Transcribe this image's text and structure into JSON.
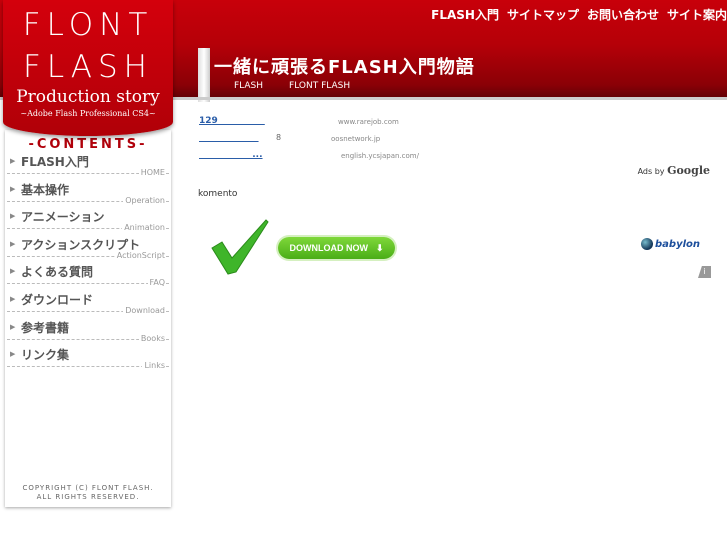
{
  "logo": {
    "line1": "FLONT",
    "line2": "FLASH",
    "line3": "Production story",
    "line4": "~Adobe Flash Professional CS4~"
  },
  "topnav": [
    "FLASH入門",
    "サイトマップ",
    "お問い合わせ",
    "サイト案内"
  ],
  "site_title": "一緒に頑張るFLASH入門物語",
  "subnav": [
    "FLASH",
    "FLONT FLASH"
  ],
  "sidebar": {
    "heading": "-CONTENTS-",
    "items": [
      {
        "jp": "FLASH入門",
        "en": "HOME"
      },
      {
        "jp": "基本操作",
        "en": "Operation"
      },
      {
        "jp": "アニメーション",
        "en": "Animation"
      },
      {
        "jp": "アクションスクリプト",
        "en": "ActionScript"
      },
      {
        "jp": "よくある質問",
        "en": "FAQ"
      },
      {
        "jp": "ダウンロード",
        "en": "Download"
      },
      {
        "jp": "参考書籍",
        "en": "Books"
      },
      {
        "jp": "リンク集",
        "en": "Links"
      }
    ],
    "copyright1": "COPYRIGHT (C) FLONT FLASH.",
    "copyright2": "ALL RIGHTS RESERVED."
  },
  "ads": [
    {
      "link": "129               ",
      "extra": "",
      "url": "www.rarejob.com"
    },
    {
      "link": "                   ",
      "extra": "8",
      "url": "oosnetwork.jp"
    },
    {
      "link": "                 ...",
      "extra": "",
      "url": "english.ycsjapan.com/"
    }
  ],
  "ads_by": "Ads by",
  "ads_google": "Google",
  "komento": "komento",
  "download_label": "DOWNLOAD NOW",
  "download_arrow": "⬇",
  "babylon": "babylon",
  "info_icon": "i"
}
